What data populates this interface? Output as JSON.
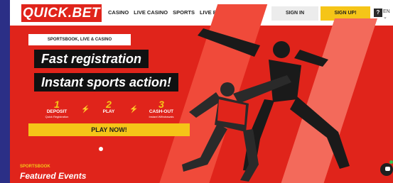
{
  "brand": {
    "logo_text": "QUICK.BET",
    "accent": "#e0241b",
    "button_yellow": "#f5c518"
  },
  "header": {
    "nav": [
      "CASINO",
      "LIVE CASINO",
      "SPORTS",
      "LIVE BETTING"
    ],
    "sign_in": "SIGN IN",
    "sign_up": "SIGN UP!",
    "help_icon": "?",
    "language": "EN"
  },
  "hero": {
    "badge": "SPORTSBOOK, LIVE & CASINO",
    "headline_1": "Fast registration",
    "headline_2": "Instant sports action!",
    "steps": [
      {
        "number": "1",
        "title": "DEPOSIT",
        "sub": "Quick Registration"
      },
      {
        "number": "2",
        "title": "PLAY",
        "sub": ""
      },
      {
        "number": "3",
        "title": "CASH-OUT",
        "sub": "Instant Withdrawals"
      }
    ],
    "cta": "PLAY NOW!",
    "image": "football-players-icon"
  },
  "section": {
    "kicker": "SPORTSBOOK",
    "title": "Featured Events"
  },
  "chat": {
    "icon": "chat-icon",
    "status_color": "#33c24d"
  }
}
